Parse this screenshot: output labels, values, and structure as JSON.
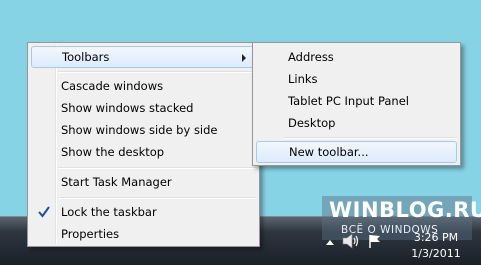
{
  "context_menu": {
    "toolbars": "Toolbars",
    "cascade": "Cascade windows",
    "stacked": "Show windows stacked",
    "side_by_side": "Show windows side by side",
    "desktop": "Show the desktop",
    "task_manager": "Start Task Manager",
    "lock_taskbar": "Lock the taskbar",
    "lock_checked": true,
    "properties": "Properties"
  },
  "toolbars_submenu": {
    "address": "Address",
    "links": "Links",
    "tablet": "Tablet PC Input Panel",
    "desktop": "Desktop",
    "new_toolbar": "New toolbar..."
  },
  "tray": {
    "time": "3:26 PM",
    "date": "1/3/2011",
    "icons": [
      "show-hidden-icons-arrow",
      "speaker-icon",
      "action-center-flag-icon"
    ]
  },
  "watermark": {
    "title": "WINBLOG.RU",
    "subtitle": "ВСЁ О WINDOWS"
  },
  "colors": {
    "desktop": "#87d3e6",
    "menu_bg": "#f0f0f0",
    "highlight_border": "#a8c9ee"
  }
}
